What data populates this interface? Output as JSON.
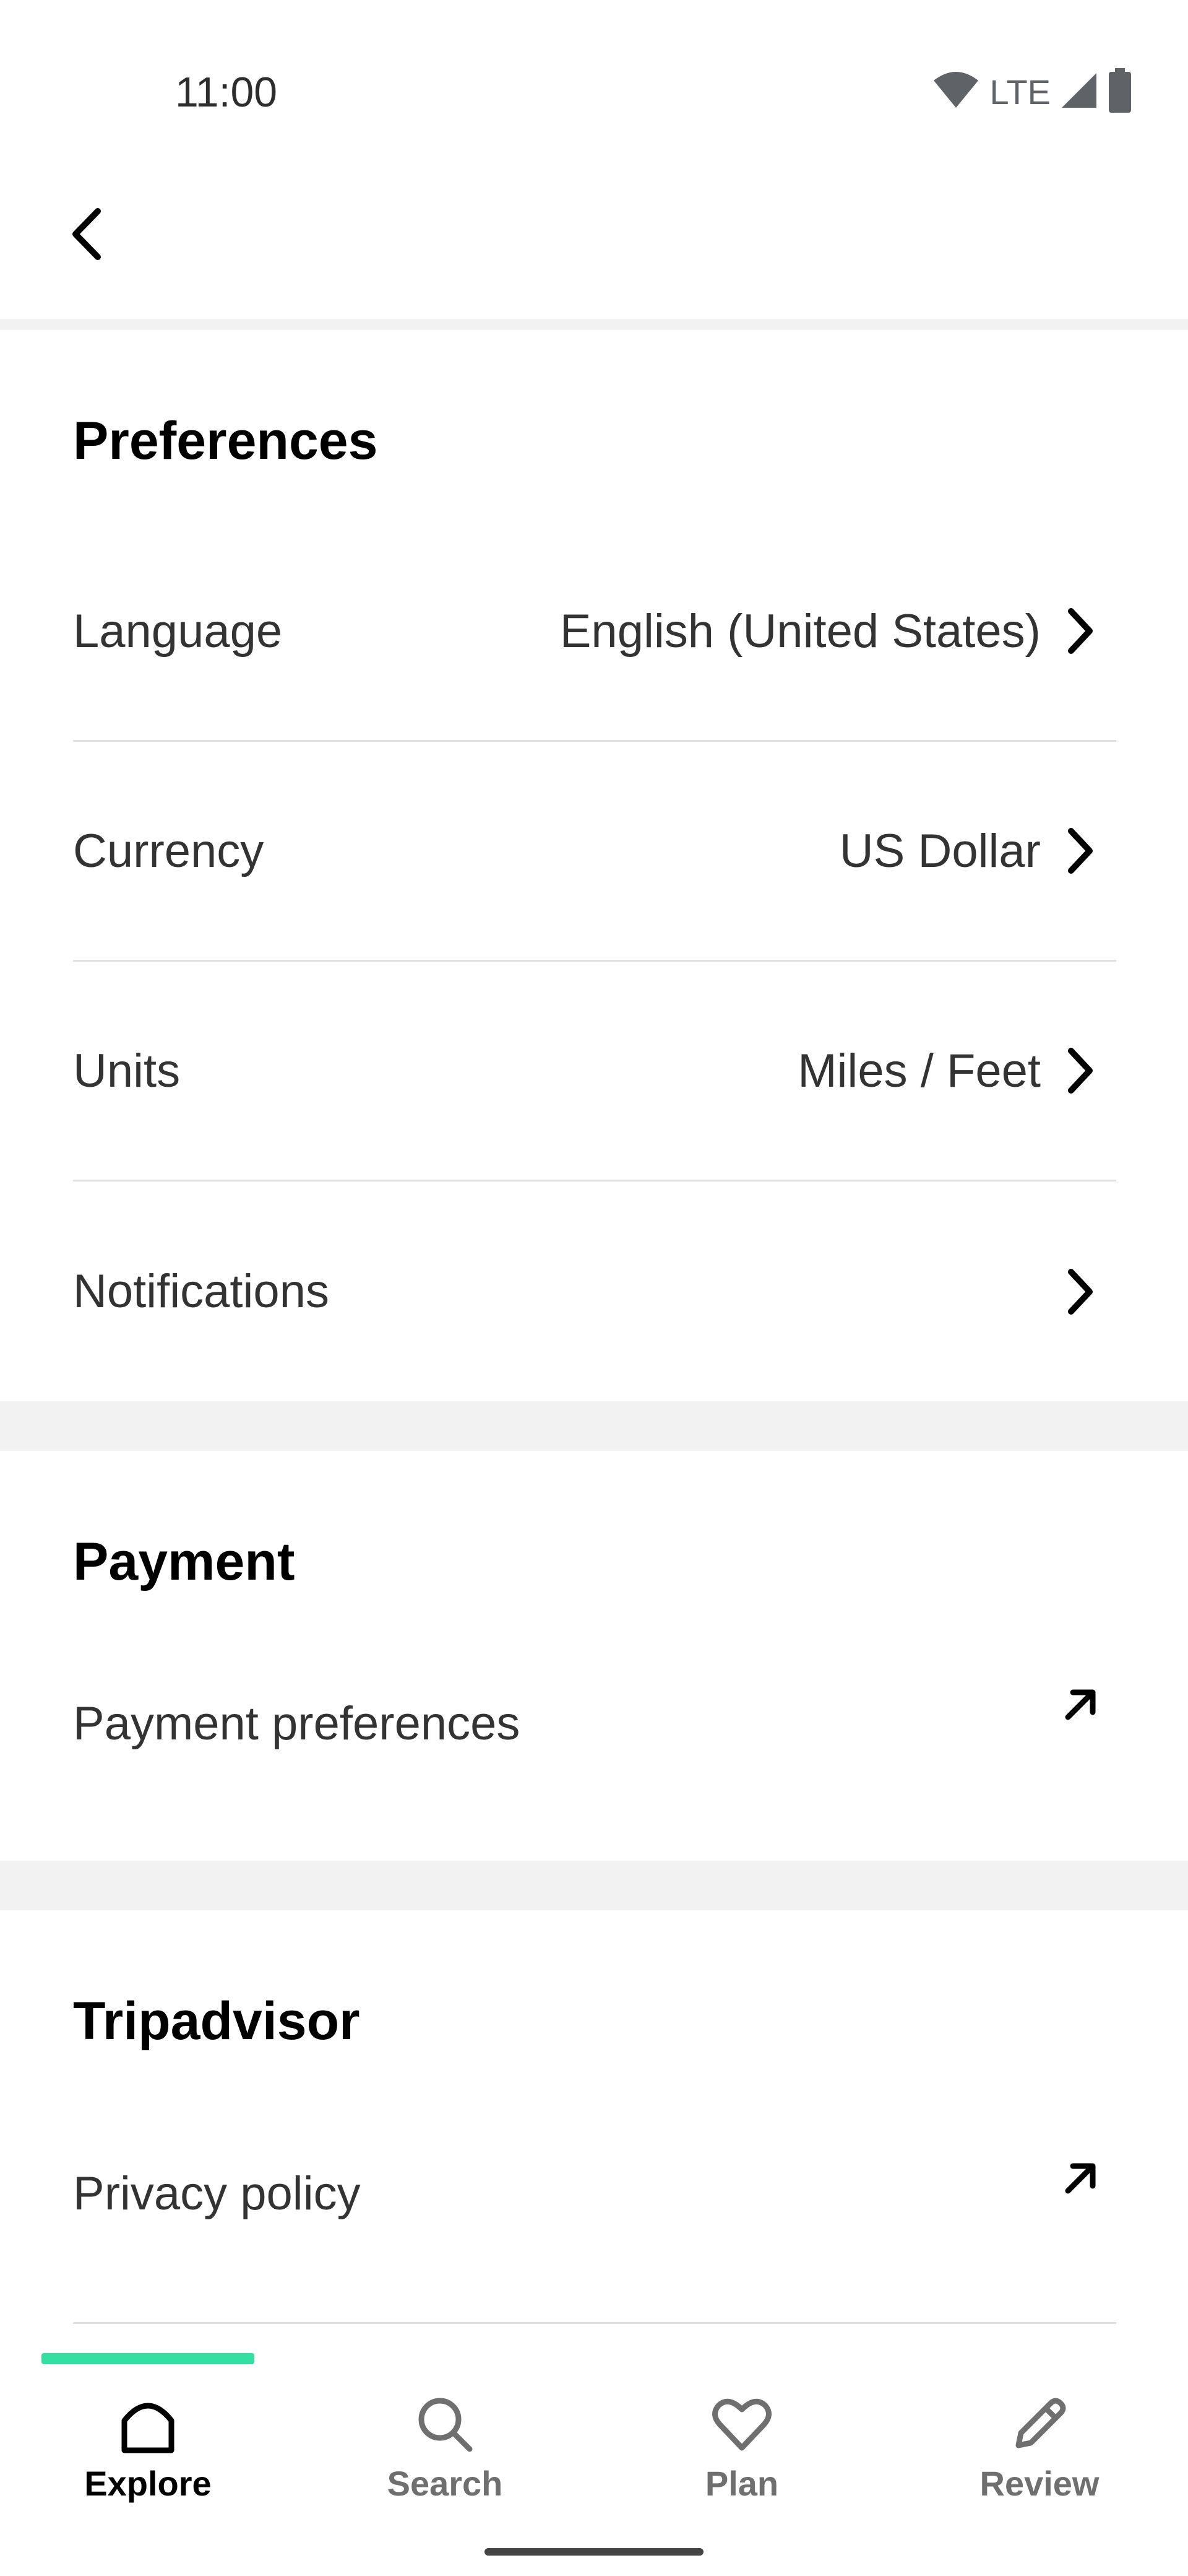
{
  "status_bar": {
    "time": "11:00",
    "network": "LTE",
    "icons": [
      "wifi-icon",
      "signal-icon",
      "battery-icon"
    ]
  },
  "app_bar": {
    "back_icon": "chevron-left-icon"
  },
  "sections": {
    "preferences": {
      "title": "Preferences",
      "rows": [
        {
          "label": "Language",
          "value": "English (United States)",
          "icon": "chevron-right-icon"
        },
        {
          "label": "Currency",
          "value": "US Dollar",
          "icon": "chevron-right-icon"
        },
        {
          "label": "Units",
          "value": "Miles / Feet",
          "icon": "chevron-right-icon"
        },
        {
          "label": "Notifications",
          "value": "",
          "icon": "chevron-right-icon"
        }
      ]
    },
    "payment": {
      "title": "Payment",
      "rows": [
        {
          "label": "Payment preferences",
          "icon": "external-link-icon"
        }
      ]
    },
    "tripadvisor": {
      "title": "Tripadvisor",
      "rows": [
        {
          "label": "Privacy policy",
          "icon": "external-link-icon"
        }
      ]
    }
  },
  "bottom_nav": {
    "items": [
      {
        "label": "Explore",
        "icon": "home-icon",
        "active": true
      },
      {
        "label": "Search",
        "icon": "search-icon",
        "active": false
      },
      {
        "label": "Plan",
        "icon": "heart-icon",
        "active": false
      },
      {
        "label": "Review",
        "icon": "pencil-icon",
        "active": false
      }
    ]
  },
  "colors": {
    "accent": "#34e0a1",
    "text_primary": "#000000",
    "text_secondary": "#333333",
    "nav_inactive": "#6f6f6f",
    "divider": "#e0e0e0",
    "band": "#f2f2f2"
  }
}
